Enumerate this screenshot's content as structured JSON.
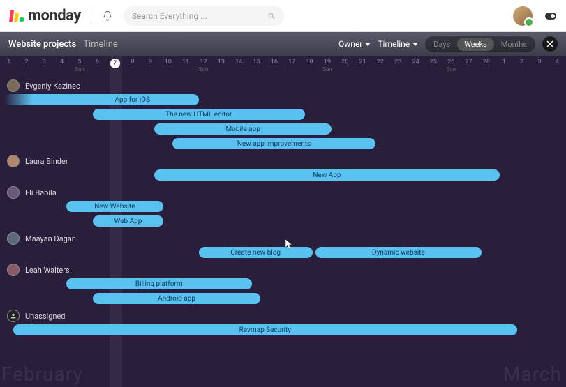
{
  "header": {
    "brand": "monday",
    "search_placeholder": "Search Everything ..."
  },
  "board": {
    "title": "Website projects",
    "subtitle": "Timeline",
    "group_by_label": "Owner",
    "view_label": "Timeline",
    "scale": {
      "days": "Days",
      "weeks": "Weeks",
      "months": "Months",
      "active": "weeks"
    }
  },
  "axis": {
    "days": [
      {
        "n": "1"
      },
      {
        "n": "2"
      },
      {
        "n": "3"
      },
      {
        "n": "4"
      },
      {
        "n": "5",
        "sub": "Sun"
      },
      {
        "n": "6"
      },
      {
        "n": "7",
        "today": true
      },
      {
        "n": "8"
      },
      {
        "n": "9"
      },
      {
        "n": "10"
      },
      {
        "n": "11"
      },
      {
        "n": "12",
        "sub": "Sun"
      },
      {
        "n": "13"
      },
      {
        "n": "14"
      },
      {
        "n": "15"
      },
      {
        "n": "16"
      },
      {
        "n": "17"
      },
      {
        "n": "18"
      },
      {
        "n": "19",
        "sub": "Sun"
      },
      {
        "n": "20"
      },
      {
        "n": "21"
      },
      {
        "n": "22"
      },
      {
        "n": "23"
      },
      {
        "n": "24"
      },
      {
        "n": "25"
      },
      {
        "n": "26",
        "sub": "Sun"
      },
      {
        "n": "27"
      },
      {
        "n": "28"
      },
      {
        "n": "1"
      },
      {
        "n": "2"
      },
      {
        "n": "3"
      },
      {
        "n": "4"
      }
    ],
    "today_index": 6
  },
  "months": {
    "left": "February",
    "right": "March"
  },
  "rows": [
    {
      "person": "Evgeniy Kazinec",
      "avatar_color": "#7a6a5a",
      "bars": [
        {
          "label": "",
          "start": 0,
          "end": 4,
          "fade": true,
          "track": 0
        },
        {
          "label": "App for iOS",
          "start": 3.5,
          "end": 11,
          "track": 0
        },
        {
          "label": "The new HTML editor",
          "start": 5,
          "end": 17,
          "track": 1
        },
        {
          "label": "Mobile app",
          "start": 8.5,
          "end": 18.5,
          "track": 2
        },
        {
          "label": "New app improvements",
          "start": 9.5,
          "end": 21,
          "track": 3
        }
      ]
    },
    {
      "person": "Laura Binder",
      "avatar_color": "#b0856a",
      "bars": [
        {
          "label": "New App",
          "start": 8.5,
          "end": 28,
          "track": 0
        }
      ]
    },
    {
      "person": "Eli Babila",
      "avatar_color": "#6a5a7a",
      "bars": [
        {
          "label": "New Website",
          "start": 3.5,
          "end": 9,
          "track": 0
        },
        {
          "label": "Web App",
          "start": 5,
          "end": 9,
          "track": 1
        }
      ]
    },
    {
      "person": "Maayan Dagan",
      "avatar_color": "#5a6a7a",
      "bars": [
        {
          "label_split": [
            "Create new blog",
            "Dynamic website"
          ],
          "start": 11,
          "end": 27,
          "split_at": 17.5,
          "track": 0
        }
      ]
    },
    {
      "person": "Leah Walters",
      "avatar_color": "#8a5a6a",
      "bars": [
        {
          "label": "Billing platform",
          "start": 3.5,
          "end": 14,
          "track": 0
        },
        {
          "label": "Android app",
          "start": 5,
          "end": 14.5,
          "track": 1
        }
      ]
    },
    {
      "person": "Unassigned",
      "unassigned": true,
      "bars": [
        {
          "label": "Revmap Security",
          "start": 0.5,
          "end": 29,
          "track": 0
        }
      ]
    }
  ]
}
